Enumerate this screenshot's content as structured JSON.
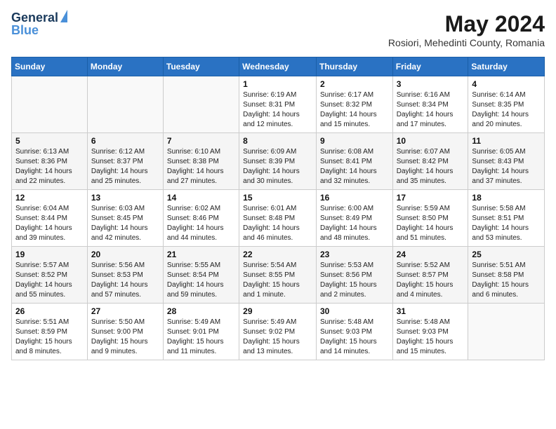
{
  "header": {
    "logo_line1": "General",
    "logo_line2": "Blue",
    "month": "May 2024",
    "location": "Rosiori, Mehedinti County, Romania"
  },
  "days_of_week": [
    "Sunday",
    "Monday",
    "Tuesday",
    "Wednesday",
    "Thursday",
    "Friday",
    "Saturday"
  ],
  "weeks": [
    [
      {
        "day": "",
        "content": ""
      },
      {
        "day": "",
        "content": ""
      },
      {
        "day": "",
        "content": ""
      },
      {
        "day": "1",
        "content": "Sunrise: 6:19 AM\nSunset: 8:31 PM\nDaylight: 14 hours\nand 12 minutes."
      },
      {
        "day": "2",
        "content": "Sunrise: 6:17 AM\nSunset: 8:32 PM\nDaylight: 14 hours\nand 15 minutes."
      },
      {
        "day": "3",
        "content": "Sunrise: 6:16 AM\nSunset: 8:34 PM\nDaylight: 14 hours\nand 17 minutes."
      },
      {
        "day": "4",
        "content": "Sunrise: 6:14 AM\nSunset: 8:35 PM\nDaylight: 14 hours\nand 20 minutes."
      }
    ],
    [
      {
        "day": "5",
        "content": "Sunrise: 6:13 AM\nSunset: 8:36 PM\nDaylight: 14 hours\nand 22 minutes."
      },
      {
        "day": "6",
        "content": "Sunrise: 6:12 AM\nSunset: 8:37 PM\nDaylight: 14 hours\nand 25 minutes."
      },
      {
        "day": "7",
        "content": "Sunrise: 6:10 AM\nSunset: 8:38 PM\nDaylight: 14 hours\nand 27 minutes."
      },
      {
        "day": "8",
        "content": "Sunrise: 6:09 AM\nSunset: 8:39 PM\nDaylight: 14 hours\nand 30 minutes."
      },
      {
        "day": "9",
        "content": "Sunrise: 6:08 AM\nSunset: 8:41 PM\nDaylight: 14 hours\nand 32 minutes."
      },
      {
        "day": "10",
        "content": "Sunrise: 6:07 AM\nSunset: 8:42 PM\nDaylight: 14 hours\nand 35 minutes."
      },
      {
        "day": "11",
        "content": "Sunrise: 6:05 AM\nSunset: 8:43 PM\nDaylight: 14 hours\nand 37 minutes."
      }
    ],
    [
      {
        "day": "12",
        "content": "Sunrise: 6:04 AM\nSunset: 8:44 PM\nDaylight: 14 hours\nand 39 minutes."
      },
      {
        "day": "13",
        "content": "Sunrise: 6:03 AM\nSunset: 8:45 PM\nDaylight: 14 hours\nand 42 minutes."
      },
      {
        "day": "14",
        "content": "Sunrise: 6:02 AM\nSunset: 8:46 PM\nDaylight: 14 hours\nand 44 minutes."
      },
      {
        "day": "15",
        "content": "Sunrise: 6:01 AM\nSunset: 8:48 PM\nDaylight: 14 hours\nand 46 minutes."
      },
      {
        "day": "16",
        "content": "Sunrise: 6:00 AM\nSunset: 8:49 PM\nDaylight: 14 hours\nand 48 minutes."
      },
      {
        "day": "17",
        "content": "Sunrise: 5:59 AM\nSunset: 8:50 PM\nDaylight: 14 hours\nand 51 minutes."
      },
      {
        "day": "18",
        "content": "Sunrise: 5:58 AM\nSunset: 8:51 PM\nDaylight: 14 hours\nand 53 minutes."
      }
    ],
    [
      {
        "day": "19",
        "content": "Sunrise: 5:57 AM\nSunset: 8:52 PM\nDaylight: 14 hours\nand 55 minutes."
      },
      {
        "day": "20",
        "content": "Sunrise: 5:56 AM\nSunset: 8:53 PM\nDaylight: 14 hours\nand 57 minutes."
      },
      {
        "day": "21",
        "content": "Sunrise: 5:55 AM\nSunset: 8:54 PM\nDaylight: 14 hours\nand 59 minutes."
      },
      {
        "day": "22",
        "content": "Sunrise: 5:54 AM\nSunset: 8:55 PM\nDaylight: 15 hours\nand 1 minute."
      },
      {
        "day": "23",
        "content": "Sunrise: 5:53 AM\nSunset: 8:56 PM\nDaylight: 15 hours\nand 2 minutes."
      },
      {
        "day": "24",
        "content": "Sunrise: 5:52 AM\nSunset: 8:57 PM\nDaylight: 15 hours\nand 4 minutes."
      },
      {
        "day": "25",
        "content": "Sunrise: 5:51 AM\nSunset: 8:58 PM\nDaylight: 15 hours\nand 6 minutes."
      }
    ],
    [
      {
        "day": "26",
        "content": "Sunrise: 5:51 AM\nSunset: 8:59 PM\nDaylight: 15 hours\nand 8 minutes."
      },
      {
        "day": "27",
        "content": "Sunrise: 5:50 AM\nSunset: 9:00 PM\nDaylight: 15 hours\nand 9 minutes."
      },
      {
        "day": "28",
        "content": "Sunrise: 5:49 AM\nSunset: 9:01 PM\nDaylight: 15 hours\nand 11 minutes."
      },
      {
        "day": "29",
        "content": "Sunrise: 5:49 AM\nSunset: 9:02 PM\nDaylight: 15 hours\nand 13 minutes."
      },
      {
        "day": "30",
        "content": "Sunrise: 5:48 AM\nSunset: 9:03 PM\nDaylight: 15 hours\nand 14 minutes."
      },
      {
        "day": "31",
        "content": "Sunrise: 5:48 AM\nSunset: 9:03 PM\nDaylight: 15 hours\nand 15 minutes."
      },
      {
        "day": "",
        "content": ""
      }
    ]
  ]
}
